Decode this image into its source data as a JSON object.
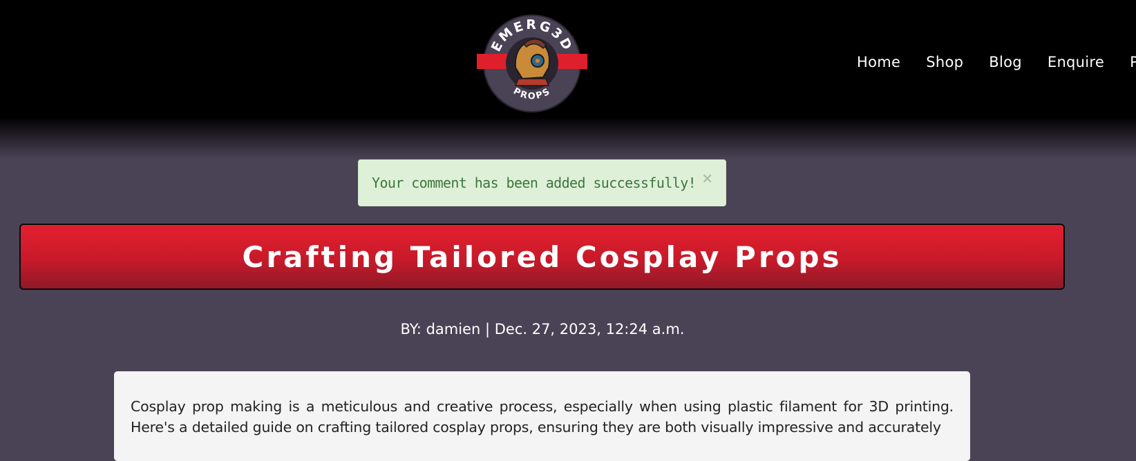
{
  "header": {
    "logo": {
      "top_text": "EMERG3D",
      "bottom_text": "PROPS",
      "colors": {
        "ring": "#4a4255",
        "band": "#e01f2d"
      }
    },
    "nav": [
      "Home",
      "Shop",
      "Blog",
      "Enquire",
      "Pro"
    ]
  },
  "alert": {
    "message": "Your comment has been added successfully!",
    "close": "×",
    "colors": {
      "background": "#dff0d8",
      "text": "#3c763d"
    }
  },
  "post": {
    "title": "Crafting Tailored Cosplay Props",
    "byline": "BY: damien | Dec. 27, 2023, 12:24 a.m.",
    "body": "Cosplay prop making is a meticulous and creative process, especially when using plastic filament for 3D printing. Here's a detailed guide on crafting tailored cosplay props, ensuring they are both visually impressive and accurately"
  },
  "colors": {
    "page_background": "#4a4255",
    "header_background": "#000000",
    "title_bar": "#e3202e"
  }
}
